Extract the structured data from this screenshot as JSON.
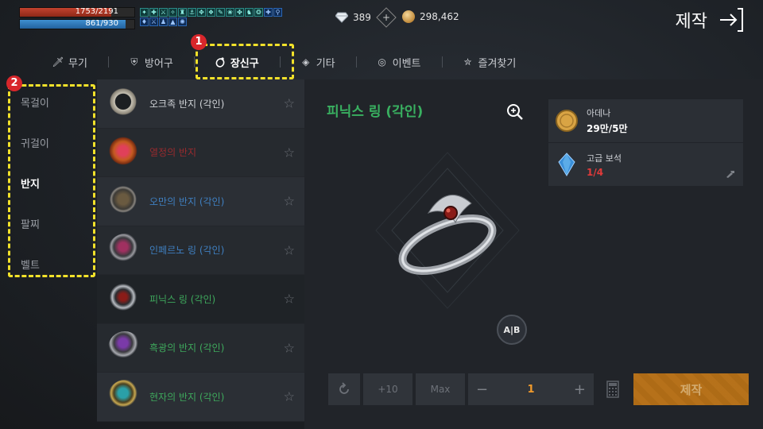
{
  "status": {
    "hp": {
      "current": 1753,
      "max": 2191,
      "text": "1753/2191"
    },
    "mp": {
      "current": 861,
      "max": 930,
      "text": "861/930"
    }
  },
  "currency": {
    "diamonds": "389",
    "adena": "298,462"
  },
  "header": {
    "title": "제작"
  },
  "tabs": [
    {
      "label": "무기",
      "icon": "sword-icon"
    },
    {
      "label": "방어구",
      "icon": "shield-icon"
    },
    {
      "label": "장신구",
      "icon": "ring-icon",
      "active": true
    },
    {
      "label": "기타",
      "icon": "box-icon"
    },
    {
      "label": "이벤트",
      "icon": "event-icon"
    },
    {
      "label": "즐겨찾기",
      "icon": "bookmark-star-icon"
    }
  ],
  "annotations": {
    "tab_badge": "1",
    "category_badge": "2"
  },
  "categories": [
    {
      "label": "목걸이"
    },
    {
      "label": "귀걸이"
    },
    {
      "label": "반지",
      "active": true
    },
    {
      "label": "팔찌"
    },
    {
      "label": "벨트"
    }
  ],
  "items": [
    {
      "name": "오크족 반지 (각인)",
      "grade_color": "#cfd2d6"
    },
    {
      "name": "열정의 반지",
      "grade_color": "#9a2a2e"
    },
    {
      "name": "오만의 반지 (각인)",
      "grade_color": "#3f7fc0"
    },
    {
      "name": "인페르노 링 (각인)",
      "grade_color": "#3f7fc0"
    },
    {
      "name": "피닉스 링 (각인)",
      "grade_color": "#3ea85c",
      "selected": true
    },
    {
      "name": "흑광의 반지 (각인)",
      "grade_color": "#3ea85c"
    },
    {
      "name": "현자의 반지 (각인)",
      "grade_color": "#3ea85c"
    }
  ],
  "detail": {
    "name": "피닉스 링 (각인)",
    "ab_label": "A|B",
    "materials": [
      {
        "label": "아데나",
        "value": "29만/5만",
        "icon": "adena-coin-icon",
        "sufficient": true
      },
      {
        "label": "고급 보석",
        "value": "1/4",
        "icon": "crystal-icon",
        "sufficient": false
      }
    ]
  },
  "controls": {
    "plus10": "+10",
    "max": "Max",
    "minus": "−",
    "quantity": "1",
    "plus": "+",
    "craft_button": "제작"
  },
  "colors": {
    "accent_orange": "#d07f18",
    "grade_green": "#3ea85c",
    "grade_blue": "#3f7fc0",
    "grade_red": "#9a2a2e",
    "shortage_red": "#e03a3a",
    "highlight_yellow": "#f2e12a"
  }
}
